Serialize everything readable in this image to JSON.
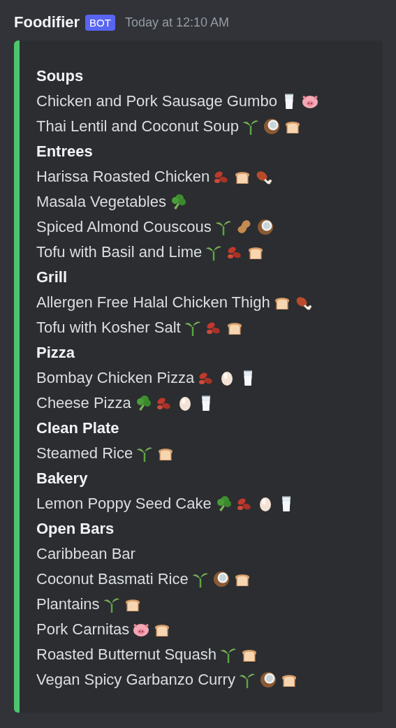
{
  "message": {
    "author": "Foodifier",
    "badge": "BOT",
    "timestamp": "Today at 12:10 AM"
  },
  "embed": {
    "sections": [
      {
        "title": "Soups",
        "items": [
          {
            "name": "Chicken and Pork Sausage Gumbo",
            "icons": [
              {
                "kind": "milk"
              },
              {
                "kind": "pig"
              }
            ]
          },
          {
            "name": "Thai Lentil and Coconut Soup",
            "icons": [
              {
                "kind": "seedling"
              },
              {
                "kind": "coconut"
              },
              {
                "kind": "bread"
              }
            ]
          }
        ]
      },
      {
        "title": "Entrees",
        "items": [
          {
            "name": "Harissa Roasted Chicken",
            "icons": [
              {
                "kind": "beans"
              },
              {
                "kind": "bread"
              },
              {
                "kind": "meat"
              }
            ]
          },
          {
            "name": "Masala Vegetables",
            "icons": [
              {
                "kind": "broccoli"
              }
            ]
          },
          {
            "name": "Spiced Almond Couscous",
            "icons": [
              {
                "kind": "seedling"
              },
              {
                "kind": "peanut"
              },
              {
                "kind": "coconut"
              }
            ]
          },
          {
            "name": "Tofu with Basil and Lime",
            "icons": [
              {
                "kind": "seedling"
              },
              {
                "kind": "beans"
              },
              {
                "kind": "bread"
              }
            ]
          }
        ]
      },
      {
        "title": "Grill",
        "items": [
          {
            "name": "Allergen Free Halal Chicken Thigh",
            "icons": [
              {
                "kind": "bread"
              },
              {
                "kind": "meat"
              }
            ]
          },
          {
            "name": "Tofu with Kosher Salt",
            "icons": [
              {
                "kind": "seedling"
              },
              {
                "kind": "beans"
              },
              {
                "kind": "bread"
              }
            ]
          }
        ]
      },
      {
        "title": "Pizza",
        "items": [
          {
            "name": "Bombay Chicken Pizza",
            "icons": [
              {
                "kind": "beans"
              },
              {
                "kind": "egg"
              },
              {
                "kind": "milk"
              }
            ]
          },
          {
            "name": "Cheese Pizza",
            "icons": [
              {
                "kind": "broccoli"
              },
              {
                "kind": "beans"
              },
              {
                "kind": "egg"
              },
              {
                "kind": "milk"
              }
            ]
          }
        ]
      },
      {
        "title": "Clean Plate",
        "items": [
          {
            "name": "Steamed Rice",
            "icons": [
              {
                "kind": "seedling"
              },
              {
                "kind": "bread"
              }
            ]
          }
        ]
      },
      {
        "title": "Bakery",
        "items": [
          {
            "name": "Lemon Poppy Seed Cake",
            "icons": [
              {
                "kind": "broccoli"
              },
              {
                "kind": "beans"
              },
              {
                "kind": "egg"
              },
              {
                "kind": "milk"
              }
            ]
          }
        ]
      },
      {
        "title": "Open Bars",
        "items": [
          {
            "name": "Caribbean Bar"
          },
          {
            "name": "Coconut Basmati Rice",
            "icons": [
              {
                "kind": "seedling"
              },
              {
                "kind": "coconut"
              },
              {
                "kind": "bread"
              }
            ]
          },
          {
            "name": "Plantains",
            "icons": [
              {
                "kind": "seedling"
              },
              {
                "kind": "bread"
              }
            ]
          },
          {
            "name": "Pork Carnitas",
            "icons": [
              {
                "kind": "pig"
              },
              {
                "kind": "bread"
              }
            ]
          },
          {
            "name": "Roasted Butternut Squash",
            "icons": [
              {
                "kind": "seedling"
              },
              {
                "kind": "bread"
              }
            ]
          },
          {
            "name": "Vegan Spicy Garbanzo Curry",
            "icons": [
              {
                "kind": "seedling"
              },
              {
                "kind": "coconut"
              },
              {
                "kind": "bread"
              }
            ]
          }
        ]
      }
    ]
  }
}
